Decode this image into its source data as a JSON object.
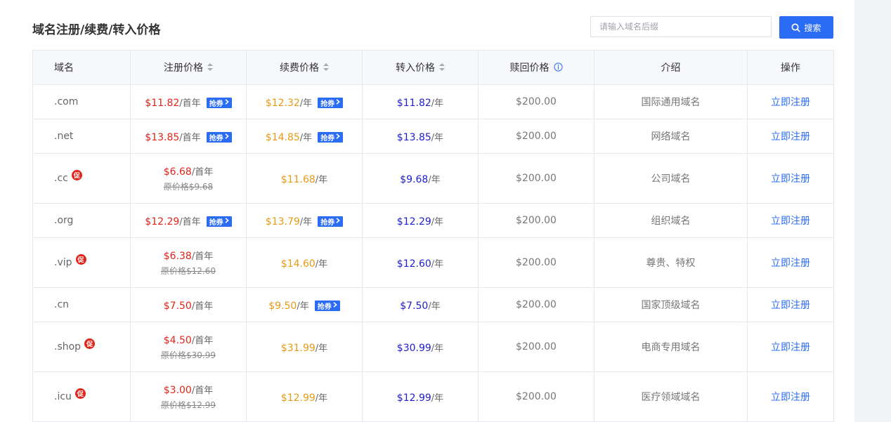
{
  "page": {
    "title": "域名注册/续费/转入价格"
  },
  "search": {
    "placeholder": "请输入域名后缀",
    "button_label": "搜索"
  },
  "table": {
    "headers": {
      "domain": "域名",
      "register": "注册价格",
      "renew": "续费价格",
      "transfer": "转入价格",
      "redeem": "赎回价格",
      "intro": "介绍",
      "action": "操作"
    },
    "coupon_label": "抢券",
    "promo_label": "促",
    "orig_prefix": "原价格",
    "first_year_unit": "/首年",
    "year_unit": "/年",
    "action_label": "立即注册",
    "rows": [
      {
        "name": ".com",
        "promo": false,
        "register": "$11.82",
        "register_coupon": true,
        "renew": "$12.32",
        "renew_coupon": true,
        "transfer": "$11.82",
        "redeem": "$200.00",
        "intro": "国际通用域名"
      },
      {
        "name": ".net",
        "promo": false,
        "register": "$13.85",
        "register_coupon": true,
        "renew": "$14.85",
        "renew_coupon": true,
        "transfer": "$13.85",
        "redeem": "$200.00",
        "intro": "网络域名"
      },
      {
        "name": ".cc",
        "promo": true,
        "register": "$6.68",
        "register_orig": "$9.68",
        "register_coupon": false,
        "renew": "$11.68",
        "renew_coupon": false,
        "transfer": "$9.68",
        "redeem": "$200.00",
        "intro": "公司域名"
      },
      {
        "name": ".org",
        "promo": false,
        "register": "$12.29",
        "register_coupon": true,
        "renew": "$13.79",
        "renew_coupon": true,
        "transfer": "$12.29",
        "redeem": "$200.00",
        "intro": "组织域名"
      },
      {
        "name": ".vip",
        "promo": true,
        "register": "$6.38",
        "register_orig": "$12.60",
        "register_coupon": false,
        "renew": "$14.60",
        "renew_coupon": false,
        "transfer": "$12.60",
        "redeem": "$200.00",
        "intro": "尊贵、特权"
      },
      {
        "name": ".cn",
        "promo": false,
        "register": "$7.50",
        "register_coupon": false,
        "renew": "$9.50",
        "renew_coupon": true,
        "transfer": "$7.50",
        "redeem": "$200.00",
        "intro": "国家顶级域名"
      },
      {
        "name": ".shop",
        "promo": true,
        "register": "$4.50",
        "register_orig": "$30.99",
        "register_coupon": false,
        "renew": "$31.99",
        "renew_coupon": false,
        "transfer": "$30.99",
        "redeem": "$200.00",
        "intro": "电商专用域名"
      },
      {
        "name": ".icu",
        "promo": true,
        "register": "$3.00",
        "register_orig": "$12.99",
        "register_coupon": false,
        "renew": "$12.99",
        "renew_coupon": false,
        "transfer": "$12.99",
        "redeem": "$200.00",
        "intro": "医疗领域域名"
      }
    ]
  },
  "colors": {
    "accent": "#2b6cf5",
    "register_price": "#e1251b",
    "renew_price": "#e59a15",
    "transfer_price": "#2020d0",
    "promo_badge": "#e1251b"
  },
  "icons": {
    "search": "search-icon",
    "sort": "sort-icon",
    "info": "info-icon",
    "coupon_arrow": "chevron-right-icon",
    "promo": "promo-badge-icon"
  }
}
